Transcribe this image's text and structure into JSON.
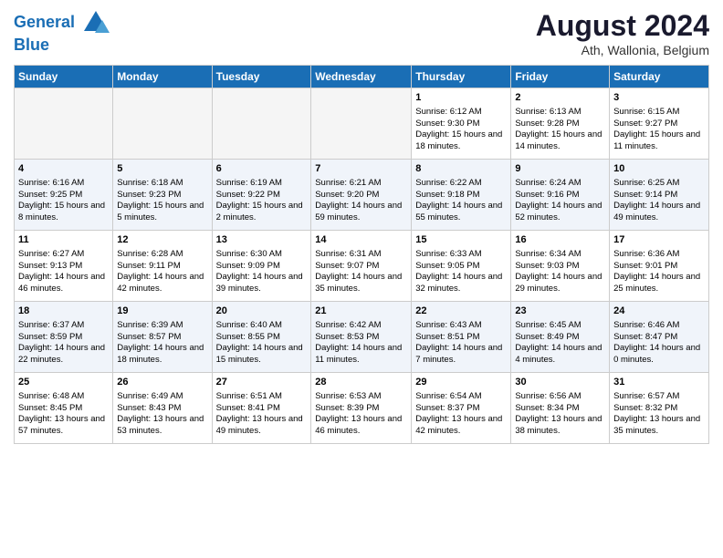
{
  "header": {
    "logo_line1": "General",
    "logo_line2": "Blue",
    "month_year": "August 2024",
    "location": "Ath, Wallonia, Belgium"
  },
  "weekdays": [
    "Sunday",
    "Monday",
    "Tuesday",
    "Wednesday",
    "Thursday",
    "Friday",
    "Saturday"
  ],
  "weeks": [
    [
      {
        "day": "",
        "text": ""
      },
      {
        "day": "",
        "text": ""
      },
      {
        "day": "",
        "text": ""
      },
      {
        "day": "",
        "text": ""
      },
      {
        "day": "1",
        "text": "Sunrise: 6:12 AM\nSunset: 9:30 PM\nDaylight: 15 hours and 18 minutes."
      },
      {
        "day": "2",
        "text": "Sunrise: 6:13 AM\nSunset: 9:28 PM\nDaylight: 15 hours and 14 minutes."
      },
      {
        "day": "3",
        "text": "Sunrise: 6:15 AM\nSunset: 9:27 PM\nDaylight: 15 hours and 11 minutes."
      }
    ],
    [
      {
        "day": "4",
        "text": "Sunrise: 6:16 AM\nSunset: 9:25 PM\nDaylight: 15 hours and 8 minutes."
      },
      {
        "day": "5",
        "text": "Sunrise: 6:18 AM\nSunset: 9:23 PM\nDaylight: 15 hours and 5 minutes."
      },
      {
        "day": "6",
        "text": "Sunrise: 6:19 AM\nSunset: 9:22 PM\nDaylight: 15 hours and 2 minutes."
      },
      {
        "day": "7",
        "text": "Sunrise: 6:21 AM\nSunset: 9:20 PM\nDaylight: 14 hours and 59 minutes."
      },
      {
        "day": "8",
        "text": "Sunrise: 6:22 AM\nSunset: 9:18 PM\nDaylight: 14 hours and 55 minutes."
      },
      {
        "day": "9",
        "text": "Sunrise: 6:24 AM\nSunset: 9:16 PM\nDaylight: 14 hours and 52 minutes."
      },
      {
        "day": "10",
        "text": "Sunrise: 6:25 AM\nSunset: 9:14 PM\nDaylight: 14 hours and 49 minutes."
      }
    ],
    [
      {
        "day": "11",
        "text": "Sunrise: 6:27 AM\nSunset: 9:13 PM\nDaylight: 14 hours and 46 minutes."
      },
      {
        "day": "12",
        "text": "Sunrise: 6:28 AM\nSunset: 9:11 PM\nDaylight: 14 hours and 42 minutes."
      },
      {
        "day": "13",
        "text": "Sunrise: 6:30 AM\nSunset: 9:09 PM\nDaylight: 14 hours and 39 minutes."
      },
      {
        "day": "14",
        "text": "Sunrise: 6:31 AM\nSunset: 9:07 PM\nDaylight: 14 hours and 35 minutes."
      },
      {
        "day": "15",
        "text": "Sunrise: 6:33 AM\nSunset: 9:05 PM\nDaylight: 14 hours and 32 minutes."
      },
      {
        "day": "16",
        "text": "Sunrise: 6:34 AM\nSunset: 9:03 PM\nDaylight: 14 hours and 29 minutes."
      },
      {
        "day": "17",
        "text": "Sunrise: 6:36 AM\nSunset: 9:01 PM\nDaylight: 14 hours and 25 minutes."
      }
    ],
    [
      {
        "day": "18",
        "text": "Sunrise: 6:37 AM\nSunset: 8:59 PM\nDaylight: 14 hours and 22 minutes."
      },
      {
        "day": "19",
        "text": "Sunrise: 6:39 AM\nSunset: 8:57 PM\nDaylight: 14 hours and 18 minutes."
      },
      {
        "day": "20",
        "text": "Sunrise: 6:40 AM\nSunset: 8:55 PM\nDaylight: 14 hours and 15 minutes."
      },
      {
        "day": "21",
        "text": "Sunrise: 6:42 AM\nSunset: 8:53 PM\nDaylight: 14 hours and 11 minutes."
      },
      {
        "day": "22",
        "text": "Sunrise: 6:43 AM\nSunset: 8:51 PM\nDaylight: 14 hours and 7 minutes."
      },
      {
        "day": "23",
        "text": "Sunrise: 6:45 AM\nSunset: 8:49 PM\nDaylight: 14 hours and 4 minutes."
      },
      {
        "day": "24",
        "text": "Sunrise: 6:46 AM\nSunset: 8:47 PM\nDaylight: 14 hours and 0 minutes."
      }
    ],
    [
      {
        "day": "25",
        "text": "Sunrise: 6:48 AM\nSunset: 8:45 PM\nDaylight: 13 hours and 57 minutes."
      },
      {
        "day": "26",
        "text": "Sunrise: 6:49 AM\nSunset: 8:43 PM\nDaylight: 13 hours and 53 minutes."
      },
      {
        "day": "27",
        "text": "Sunrise: 6:51 AM\nSunset: 8:41 PM\nDaylight: 13 hours and 49 minutes."
      },
      {
        "day": "28",
        "text": "Sunrise: 6:53 AM\nSunset: 8:39 PM\nDaylight: 13 hours and 46 minutes."
      },
      {
        "day": "29",
        "text": "Sunrise: 6:54 AM\nSunset: 8:37 PM\nDaylight: 13 hours and 42 minutes."
      },
      {
        "day": "30",
        "text": "Sunrise: 6:56 AM\nSunset: 8:34 PM\nDaylight: 13 hours and 38 minutes."
      },
      {
        "day": "31",
        "text": "Sunrise: 6:57 AM\nSunset: 8:32 PM\nDaylight: 13 hours and 35 minutes."
      }
    ]
  ]
}
